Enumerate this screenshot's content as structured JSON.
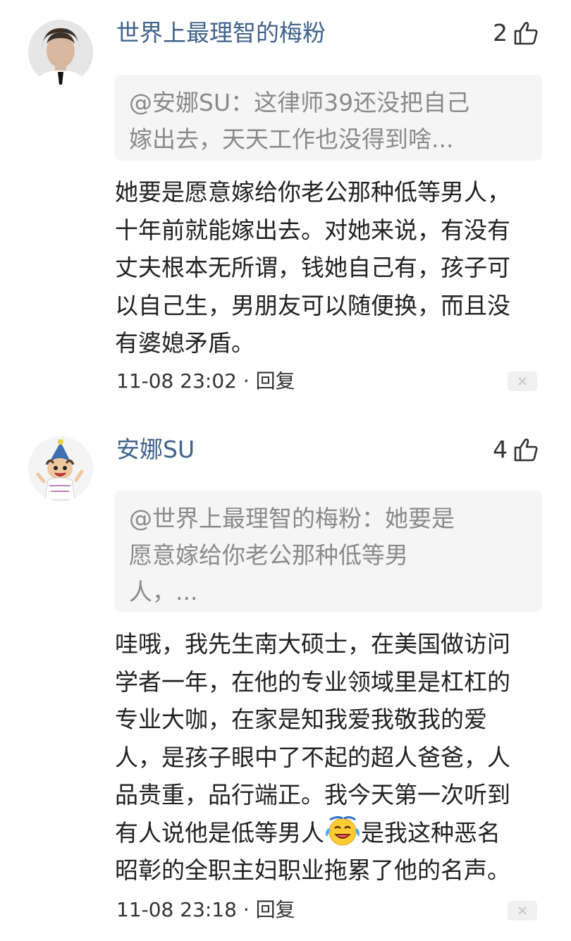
{
  "comments": [
    {
      "username": "世界上最理智的梅粉",
      "likes": "2",
      "quote_lines": [
        "@安娜SU：这律师39还没把自己",
        "嫁出去，天天工作也没得到啥..."
      ],
      "body_lines": [
        "她要是愿意嫁给你老公那种低等男人，",
        "十年前就能嫁出去。对她来说，有没有",
        "丈夫根本无所谓，钱她自己有，孩子可",
        "以自己生，男朋友可以随便换，而且没",
        "有婆媳矛盾。"
      ],
      "timestamp": "11-08 23:02",
      "separator": " · ",
      "reply_label": "回复"
    },
    {
      "username": "安娜SU",
      "likes": "4",
      "quote_lines": [
        "@世界上最理智的梅粉：她要是",
        "愿意嫁给你老公那种低等男",
        "人，..."
      ],
      "body_lines": [
        "哇哦，我先生南大硕士，在美国做访问",
        "学者一年，在他的专业领域里是杠杠的",
        "专业大咖，在家是知我爱我敬我的爱",
        "人，是孩子眼中了不起的超人爸爸，人",
        "品贵重，品行端正。我今天第一次听到"
      ],
      "body_line6_before": "有人说他是低等男人",
      "body_line6_after": "是我这种恶名",
      "body_line7": "昭彰的全职主妇职业拖累了他的名声。",
      "timestamp": "11-08 23:18",
      "separator": " · ",
      "reply_label": "回复"
    }
  ],
  "icons": {
    "like": "thumbs-up-icon",
    "close": "close-icon",
    "emoji": "crying-laughing-emoji-icon"
  },
  "colors": {
    "username": "#40638c",
    "quote_bg": "#f5f5f5",
    "quote_text": "#8a8a8a",
    "body_text": "#222222"
  }
}
